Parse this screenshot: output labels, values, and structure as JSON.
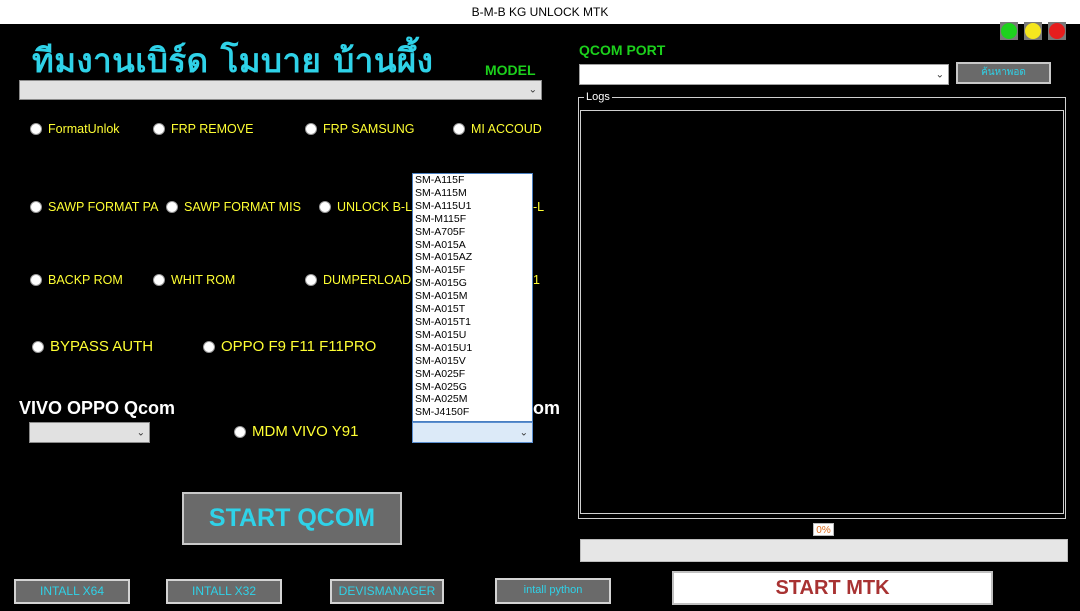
{
  "window": {
    "title": "B-M-B KG UNLOCK MTK"
  },
  "status_lights": [
    {
      "name": "green-light",
      "color": "#1ed21e"
    },
    {
      "name": "yellow-light",
      "color": "#f5e61e"
    },
    {
      "name": "red-light",
      "color": "#e61e1e"
    }
  ],
  "header": {
    "thai_title": "ทีมงานเบิร์ด โมบาย บ้านผึ้ง",
    "model_label": "MODEL"
  },
  "model_combo": {
    "value": ""
  },
  "radios": {
    "format_unlok": "FormatUnlok",
    "frp_remove": "FRP REMOVE",
    "frp_samsung": "FRP SAMSUNG",
    "mi_accoud": "MI ACCOUD",
    "sawp_format_pa": "SAWP FORMAT PA",
    "sawp_format_mis": "SAWP FORMAT MIS",
    "unlock_bl": "UNLOCK B-L",
    "hidden_bl": "-L",
    "backp_rom": "BACKP ROM",
    "whit_rom": "WHIT ROM",
    "dumperload": "DUMPERLOAD",
    "hidden_1": "1",
    "bypass_auth": "BYPASS AUTH",
    "oppo_f9": "OPPO F9 F11 F11PRO",
    "mdm_vivo": "MDM VIVO Y91"
  },
  "sections": {
    "vivo_oppo_qcom": "VIVO OPPO Qcom",
    "samsung_qcom_partial": "om"
  },
  "samsung_models": [
    "SM-A115F",
    "SM-A115M",
    "SM-A115U1",
    "SM-M115F",
    "SM-A705F",
    "SM-A015A",
    "SM-A015AZ",
    "SM-A015F",
    "SM-A015G",
    "SM-A015M",
    "SM-A015T",
    "SM-A015T1",
    "SM-A015U",
    "SM-A015U1",
    "SM-A015V",
    "SM-A025F",
    "SM-A025G",
    "SM-A025M",
    "SM-J4150F"
  ],
  "buttons": {
    "start_qcom": "START QCOM",
    "intall_x64": "INTALL X64",
    "intall_x32": "INTALL X32",
    "devismanager": "DEVISMANAGER",
    "intall_python": "intall python",
    "start_mtk": "START MTK",
    "search_port": "ค้นหาพอด"
  },
  "qcom": {
    "port_label": "QCOM PORT",
    "port_value": ""
  },
  "logs": {
    "legend": "Logs",
    "content": ""
  },
  "progress": {
    "percent_text": "0%",
    "value": 0
  },
  "colors": {
    "cyan": "#2fd2e8",
    "yellow": "#ffff33",
    "green": "#1cd01c",
    "mtk_red": "#a83232"
  }
}
